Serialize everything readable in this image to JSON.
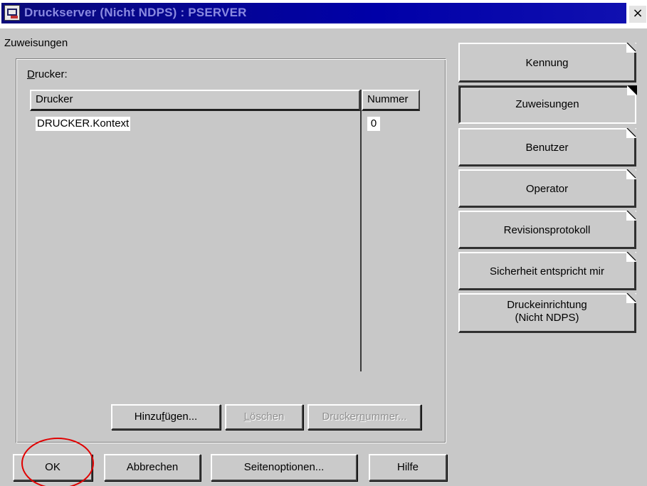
{
  "window": {
    "title": "Druckserver (Nicht NDPS) : PSERVER",
    "close_label": "×"
  },
  "section": {
    "label": "Zuweisungen"
  },
  "printers_group": {
    "label_prefix": "",
    "label_accel": "D",
    "label_rest": "rucker:",
    "columns": [
      "Drucker",
      "Nummer"
    ],
    "rows": [
      {
        "name": "DRUCKER.Kontext",
        "number": "0"
      }
    ]
  },
  "list_buttons": {
    "add": {
      "pre": "Hinzu",
      "accel": "f",
      "post": "ügen..."
    },
    "delete": {
      "pre": "",
      "accel": "L",
      "post": "öschen"
    },
    "printer_number": {
      "pre": "Drucker",
      "accel": "n",
      "post": "ummer..."
    }
  },
  "dialog_buttons": {
    "ok": "OK",
    "cancel": "Abbrechen",
    "page_options": "Seitenoptionen...",
    "help": "Hilfe"
  },
  "page_tabs": [
    {
      "label": "Kennung",
      "active": false
    },
    {
      "label": "Zuweisungen",
      "active": true
    },
    {
      "label": "Benutzer",
      "active": false
    },
    {
      "label": "Operator",
      "active": false
    },
    {
      "label": "Revisionsprotokoll",
      "active": false
    },
    {
      "label": "Sicherheit entspricht mir",
      "active": false
    },
    {
      "label": "Druckeinrichtung",
      "label_line2": "(Nicht NDPS)",
      "active": false
    }
  ],
  "colors": {
    "titlebar": "#0000a8",
    "title_text": "#8a8ae0",
    "face": "#c8c8c8",
    "annotation": "#e00000"
  },
  "icons": {
    "app": "printer-server-icon",
    "close": "close-icon"
  }
}
